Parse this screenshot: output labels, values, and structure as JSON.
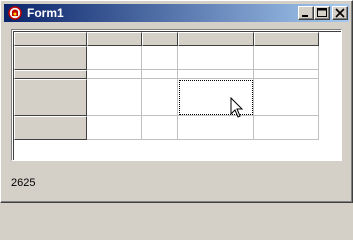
{
  "window": {
    "title": "Form1"
  },
  "titlebar": {
    "app_icon": "torchbearer-icon",
    "controls": [
      {
        "name": "minimize",
        "icon": "minimize-icon"
      },
      {
        "name": "maximize",
        "icon": "maximize-icon"
      },
      {
        "name": "close",
        "icon": "close-icon"
      }
    ]
  },
  "grid": {
    "fixed_rows": 1,
    "fixed_cols": 1,
    "row_count": 5,
    "col_count": 5,
    "focused_cell": {
      "row": 3,
      "col": 3
    },
    "cells": []
  },
  "status_label": "2625",
  "colors": {
    "titlebar_start": "#0a246a",
    "titlebar_end": "#a6caf0",
    "face": "#d4d0c8"
  }
}
